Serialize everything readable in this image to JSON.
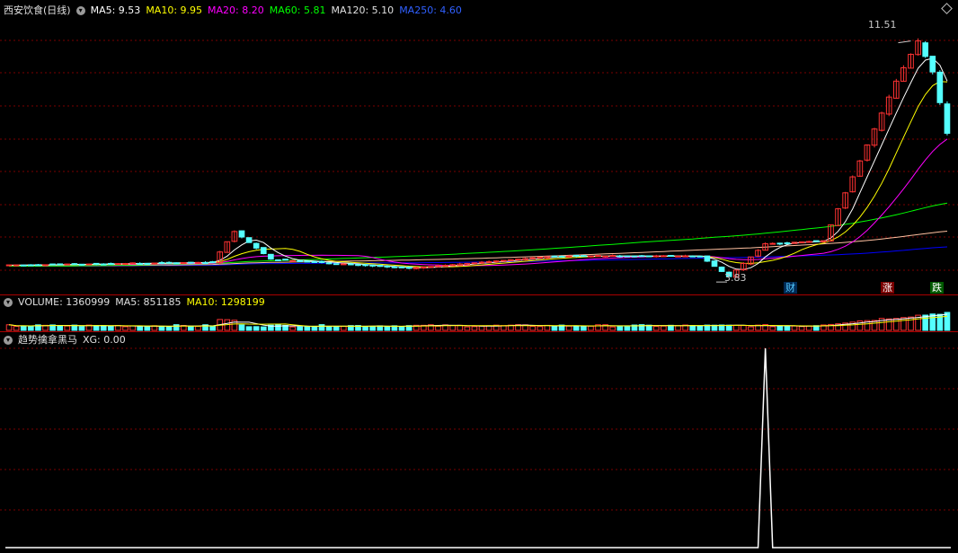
{
  "main_header": {
    "title": "西安饮食(日线)",
    "ma5": "MA5: 9.53",
    "ma10": "MA10: 9.95",
    "ma20": "MA20: 8.20",
    "ma60": "MA60: 5.81",
    "ma120": "MA120: 5.10",
    "ma250": "MA250: 4.60"
  },
  "volume_header": {
    "label": "VOLUME: 1360999",
    "ma5": "MA5: 851185",
    "ma10": "MA10: 1298199"
  },
  "indicator_header": {
    "label": "趋势擒拿黑马",
    "xg": "XG: 0.00"
  },
  "annotations": {
    "high_label": "11.51",
    "low_label": "3.83",
    "marker_cai": "财",
    "marker_zhang": "涨",
    "marker_die": "跌"
  },
  "colors": {
    "up": "#ff3232",
    "down": "#54ffff",
    "ma5": "#ffffff",
    "ma10": "#ffff00",
    "ma20": "#ff00ff",
    "ma60": "#00ff00",
    "ma120": "#ffc0a0",
    "ma250": "#0000ff",
    "grid": "#7a0000"
  },
  "chart_data": [
    {
      "type": "candlestick",
      "title": "西安饮食(日线)",
      "ylim": [
        3.6,
        12.2
      ],
      "x_count": 130,
      "segments": [
        {
          "from": 0,
          "to": 28,
          "start": 4.2,
          "end": 4.3
        },
        {
          "from": 28,
          "to": 31,
          "start": 4.3,
          "end": 5.3
        },
        {
          "from": 31,
          "to": 36,
          "start": 5.3,
          "end": 4.4
        },
        {
          "from": 36,
          "to": 55,
          "start": 4.4,
          "end": 4.1
        },
        {
          "from": 55,
          "to": 75,
          "start": 4.1,
          "end": 4.5
        },
        {
          "from": 75,
          "to": 95,
          "start": 4.5,
          "end": 4.5
        },
        {
          "from": 95,
          "to": 99,
          "start": 4.5,
          "end": 3.83
        },
        {
          "from": 99,
          "to": 104,
          "start": 3.83,
          "end": 4.9
        },
        {
          "from": 104,
          "to": 112,
          "start": 4.9,
          "end": 5.0
        },
        {
          "from": 112,
          "to": 122,
          "start": 5.0,
          "end": 10.2
        },
        {
          "from": 122,
          "to": 125,
          "start": 10.2,
          "end": 11.51
        },
        {
          "from": 125,
          "to": 127,
          "start": 11.51,
          "end": 10.5
        },
        {
          "from": 127,
          "to": 129,
          "start": 10.5,
          "end": 8.5
        }
      ],
      "ma_end_values": {
        "MA5": 9.53,
        "MA10": 9.95,
        "MA20": 8.2,
        "MA60": 5.81,
        "MA120": 5.1,
        "MA250": 4.6
      },
      "high": 11.51,
      "low": 3.83
    },
    {
      "type": "bar",
      "title": "VOLUME",
      "last_value": 1360999,
      "ma5": 851185,
      "ma10": 1298199
    },
    {
      "type": "line",
      "title": "趋势擒拿黑马",
      "series": [
        {
          "name": "XG",
          "spike_index": 104,
          "spike_value": 1,
          "baseline": 0
        }
      ],
      "last_value": 0.0
    }
  ]
}
